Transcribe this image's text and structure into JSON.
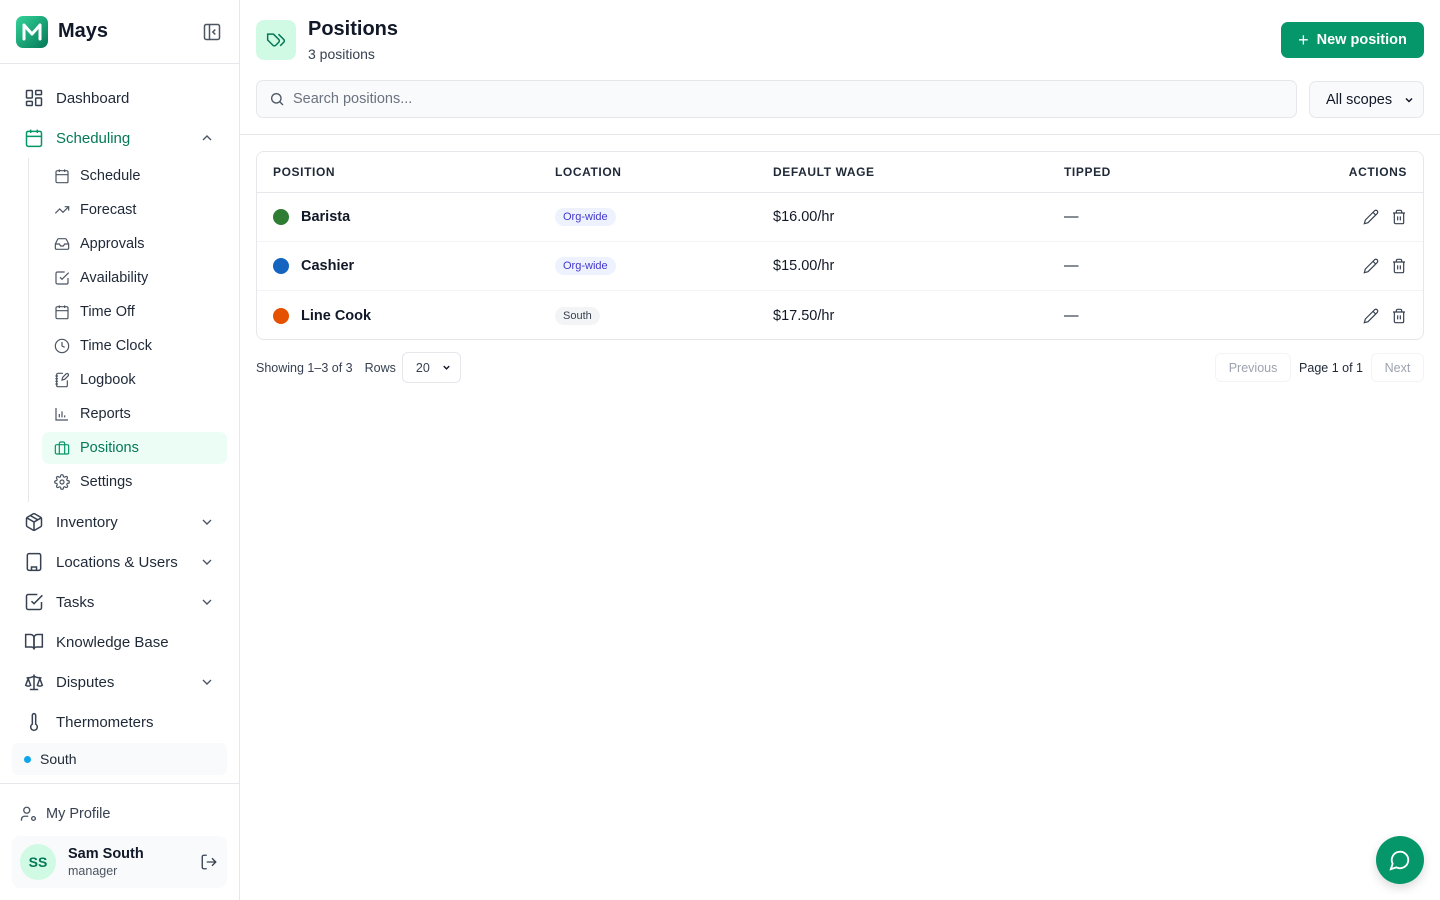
{
  "brand": {
    "name": "Mays"
  },
  "nav": {
    "dashboard": "Dashboard",
    "scheduling": "Scheduling",
    "scheduling_items": [
      "Schedule",
      "Forecast",
      "Approvals",
      "Availability",
      "Time Off",
      "Time Clock",
      "Logbook",
      "Reports",
      "Positions",
      "Settings"
    ],
    "inventory": "Inventory",
    "locations_users": "Locations & Users",
    "tasks": "Tasks",
    "knowledge_base": "Knowledge Base",
    "disputes": "Disputes",
    "thermometers": "Thermometers"
  },
  "location": {
    "name": "South",
    "dot_color": "#0ea5e9"
  },
  "profile": {
    "link": "My Profile",
    "initials": "SS",
    "name": "Sam South",
    "role": "manager"
  },
  "header": {
    "title": "Positions",
    "subtitle": "3 positions",
    "new_button": "New position",
    "search_placeholder": "Search positions...",
    "scope": "All scopes"
  },
  "table": {
    "columns": [
      "Position",
      "Location",
      "Default Wage",
      "Tipped",
      "Actions"
    ],
    "rows": [
      {
        "name": "Barista",
        "color": "#2e7d32",
        "location": "Org-wide",
        "location_kind": "org",
        "wage": "$16.00/hr",
        "tipped": "—"
      },
      {
        "name": "Cashier",
        "color": "#1565c0",
        "location": "Org-wide",
        "location_kind": "org",
        "wage": "$15.00/hr",
        "tipped": "—"
      },
      {
        "name": "Line Cook",
        "color": "#e65100",
        "location": "South",
        "location_kind": "loc",
        "wage": "$17.50/hr",
        "tipped": "—"
      }
    ]
  },
  "pagination": {
    "showing": "Showing 1–3 of 3",
    "rows_label": "Rows",
    "rows_value": "20",
    "previous": "Previous",
    "page_label": "Page 1 of 1",
    "next": "Next"
  },
  "colors": {
    "accent": "#059669",
    "accent_light": "#d1fae5",
    "active_bg": "#ecfdf5"
  }
}
